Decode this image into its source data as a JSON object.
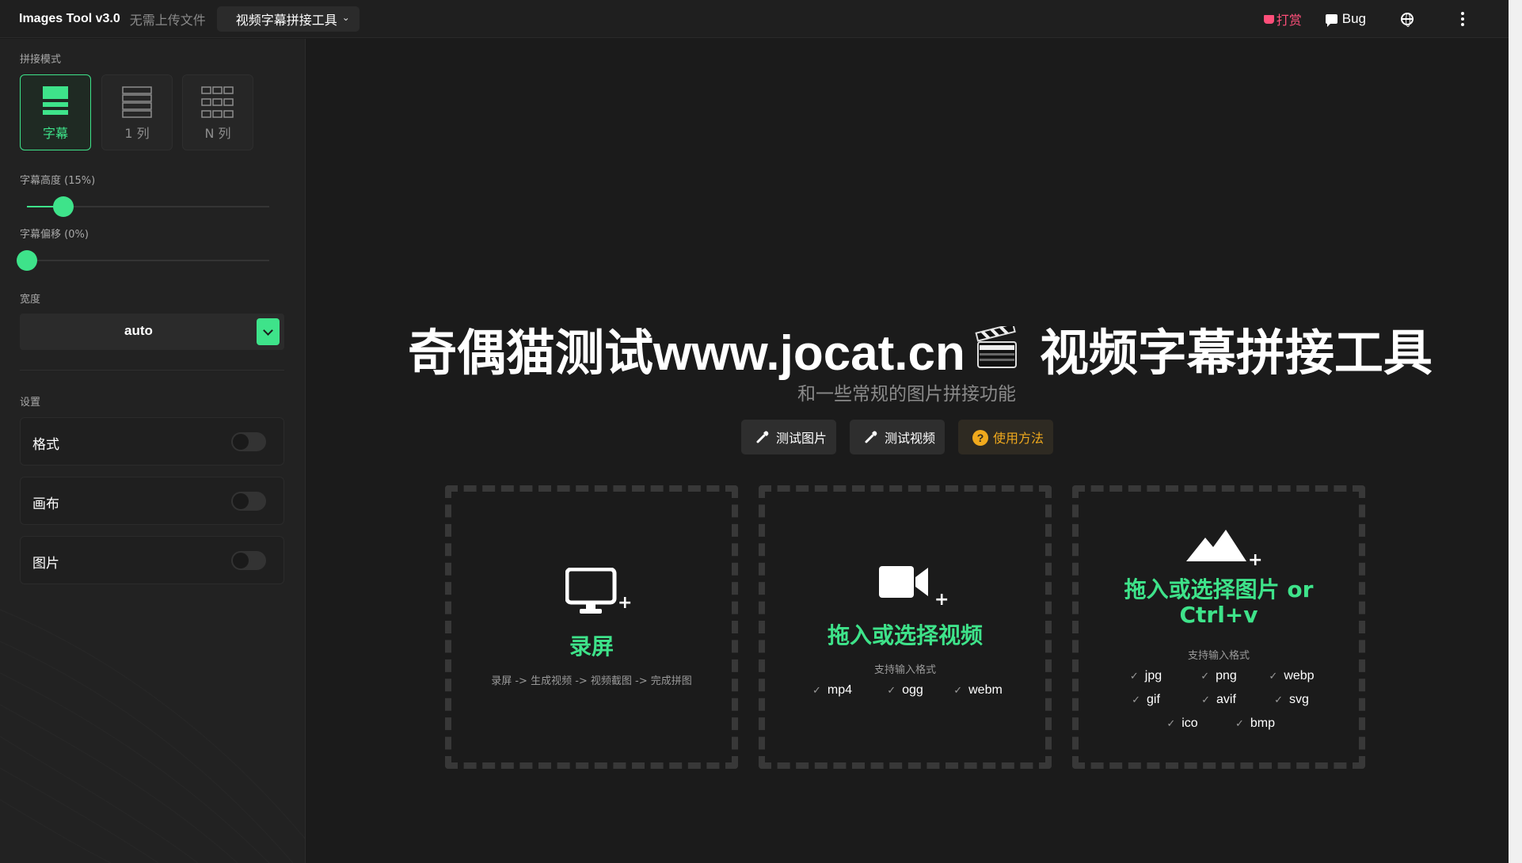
{
  "header": {
    "brand": "Images Tool v3.0",
    "brand_sub": "无需上传文件",
    "mode_select": "视频字幕拼接工具",
    "donate": "打赏",
    "bug": "Bug"
  },
  "sidebar": {
    "mode_label": "拼接模式",
    "modes": [
      {
        "label": "字幕",
        "active": true
      },
      {
        "label": "1 列",
        "active": false
      },
      {
        "label": "N 列",
        "active": false
      }
    ],
    "subtitle_height_label": "字幕高度 (15%)",
    "subtitle_height_value": 15,
    "subtitle_offset_label": "字幕偏移 (0%)",
    "subtitle_offset_value": 0,
    "width_label": "宽度",
    "width_value": "auto",
    "settings_label": "设置",
    "settings": [
      {
        "label": "格式",
        "on": false
      },
      {
        "label": "画布",
        "on": false
      },
      {
        "label": "图片",
        "on": false
      }
    ]
  },
  "main": {
    "title_left": "奇偶猫测试www.jocat.cn",
    "title_right": "视频字幕拼接工具",
    "subtitle": "和一些常规的图片拼接功能",
    "buttons": [
      "测试图片",
      "测试视频",
      "使用方法"
    ],
    "cards": {
      "record": {
        "title": "录屏",
        "hint": "录屏 -> 生成视频 -> 视频截图 -> 完成拼图"
      },
      "video": {
        "title": "拖入或选择视频",
        "hint": "支持输入格式",
        "formats": [
          "mp4",
          "ogg",
          "webm"
        ]
      },
      "image": {
        "title_line1": "拖入或选择图片 or",
        "title_line2": "Ctrl+v",
        "hint": "支持输入格式",
        "formats": [
          "jpg",
          "png",
          "webp",
          "gif",
          "avif",
          "svg",
          "ico",
          "bmp"
        ]
      }
    }
  },
  "colors": {
    "accent": "#3ee38a",
    "donate": "#ff4f7a",
    "warn": "#f0a91d"
  }
}
